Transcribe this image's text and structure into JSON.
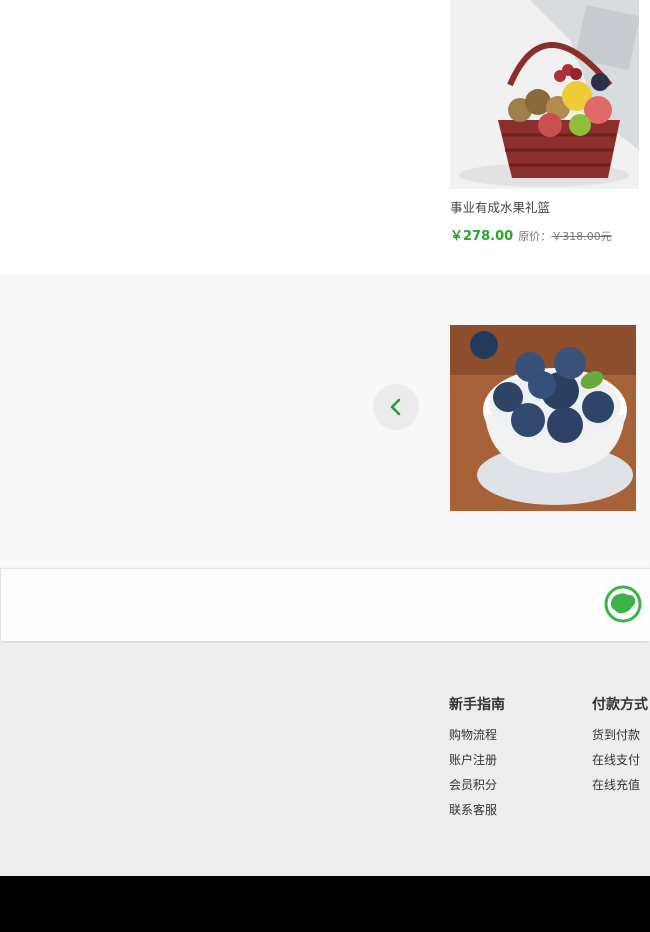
{
  "product": {
    "name": "事业有成水果礼篮",
    "price": "￥278.00",
    "orig_label": "原价：",
    "orig_price": "￥318.00元"
  },
  "carousel": {
    "prev_icon": "chevron-left-icon",
    "image2_alt": "blueberries-in-cup"
  },
  "strip": {
    "map_icon": "china-map-icon"
  },
  "footer": {
    "col1": {
      "title": "新手指南",
      "links": [
        "购物流程",
        "账户注册",
        "会员积分",
        "联系客服"
      ]
    },
    "col2": {
      "title": "付款方式",
      "links": [
        "货到付款",
        "在线支付",
        "在线充值"
      ]
    }
  },
  "colors": {
    "accent": "#2aa52a",
    "icon_green": "#3bb34a"
  }
}
